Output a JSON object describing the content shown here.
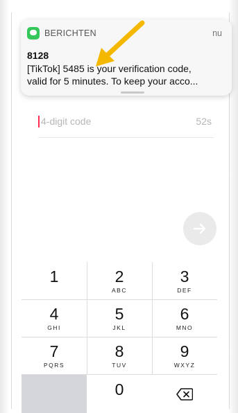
{
  "notification": {
    "app_name": "BERICHTEN",
    "time": "nu",
    "sender": "8128",
    "body_line1": "[TikTok] 5485 is your verification code,",
    "body_line2": "valid for 5 minutes. To keep your acco..."
  },
  "code_input": {
    "placeholder": "4-digit code",
    "timer": "52s"
  },
  "next_button": {
    "icon": "arrow-right-icon"
  },
  "keypad": {
    "keys": [
      {
        "num": "1",
        "letters": ""
      },
      {
        "num": "2",
        "letters": "ABC"
      },
      {
        "num": "3",
        "letters": "DEF"
      },
      {
        "num": "4",
        "letters": "GHI"
      },
      {
        "num": "5",
        "letters": "JKL"
      },
      {
        "num": "6",
        "letters": "MNO"
      },
      {
        "num": "7",
        "letters": "PQRS"
      },
      {
        "num": "8",
        "letters": "TUV"
      },
      {
        "num": "9",
        "letters": "WXYZ"
      },
      {
        "num": "0",
        "letters": ""
      }
    ],
    "delete_icon": "backspace-icon"
  },
  "colors": {
    "accent": "#fe2c55",
    "arrow_annotation": "#f5b800",
    "message_app": "#34c759"
  }
}
